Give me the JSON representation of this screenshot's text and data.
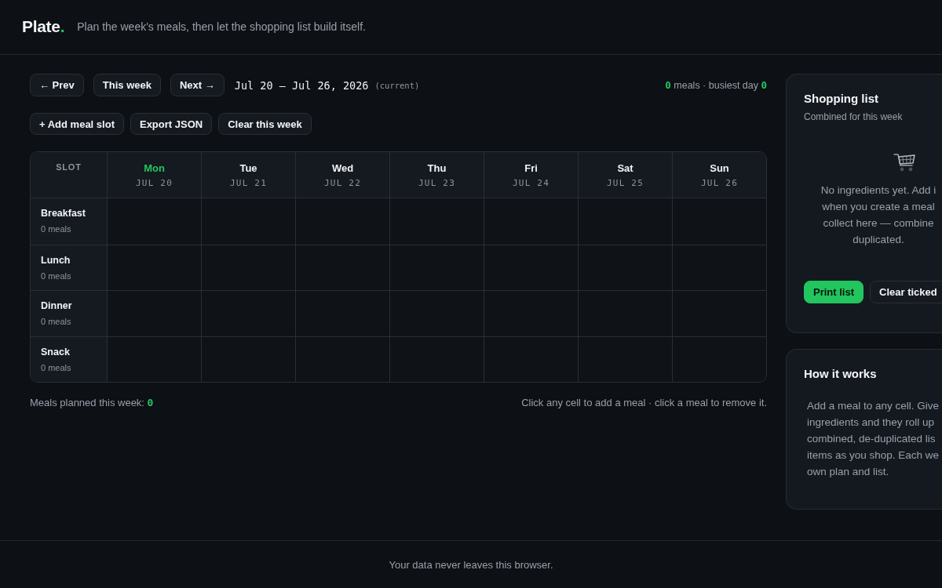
{
  "header": {
    "logo": {
      "name": "Plate",
      "mark": "."
    },
    "tagline": "Plan the week's meals, then let the shopping list build itself."
  },
  "week_nav": {
    "buttons": [
      {
        "label": "← Prev"
      },
      {
        "label": "This week"
      },
      {
        "label": "Next →"
      }
    ],
    "range": "Jul 20 – Jul 26, 2026",
    "range_note": "(current)",
    "summary": {
      "count": "0",
      "text": "meals · busiest day",
      "busiest": "0"
    }
  },
  "actions": [
    "+ Add meal slot",
    "Export JSON",
    "Clear this week"
  ],
  "planner": {
    "corner": "SLOT",
    "days": [
      {
        "name": "Mon",
        "date": "JUL 20",
        "today": true
      },
      {
        "name": "Tue",
        "date": "JUL 21",
        "today": false
      },
      {
        "name": "Wed",
        "date": "JUL 22",
        "today": false
      },
      {
        "name": "Thu",
        "date": "JUL 23",
        "today": false
      },
      {
        "name": "Fri",
        "date": "JUL 24",
        "today": false
      },
      {
        "name": "Sat",
        "date": "JUL 25",
        "today": false
      },
      {
        "name": "Sun",
        "date": "JUL 26",
        "today": false
      }
    ],
    "slots": [
      {
        "name": "Breakfast",
        "count": "0 meals"
      },
      {
        "name": "Lunch",
        "count": "0 meals"
      },
      {
        "name": "Dinner",
        "count": "0 meals"
      },
      {
        "name": "Snack",
        "count": "0 meals"
      }
    ]
  },
  "planner_footer": {
    "total_label": "Meals planned this week:",
    "total": "0",
    "hint": "Click any cell to add a meal · click a meal to remove it."
  },
  "shopping_list": {
    "title": "Shopping list",
    "subtitle": "Combined for this week",
    "empty_text": "No ingredients yet. Add i\nwhen you create a meal\ncollect here — combine\nduplicated.",
    "buttons": [
      {
        "label": "Print list",
        "kind": "primary"
      },
      {
        "label": "Clear ticked",
        "kind": "secondary"
      }
    ]
  },
  "how_it_works": {
    "title": "How it works",
    "text": "Add a meal to any cell. Give\ningredients and they roll up\ncombined, de-duplicated lis\nitems as you shop. Each we\nown plan and list."
  },
  "footer": "Your data never leaves this browser."
}
